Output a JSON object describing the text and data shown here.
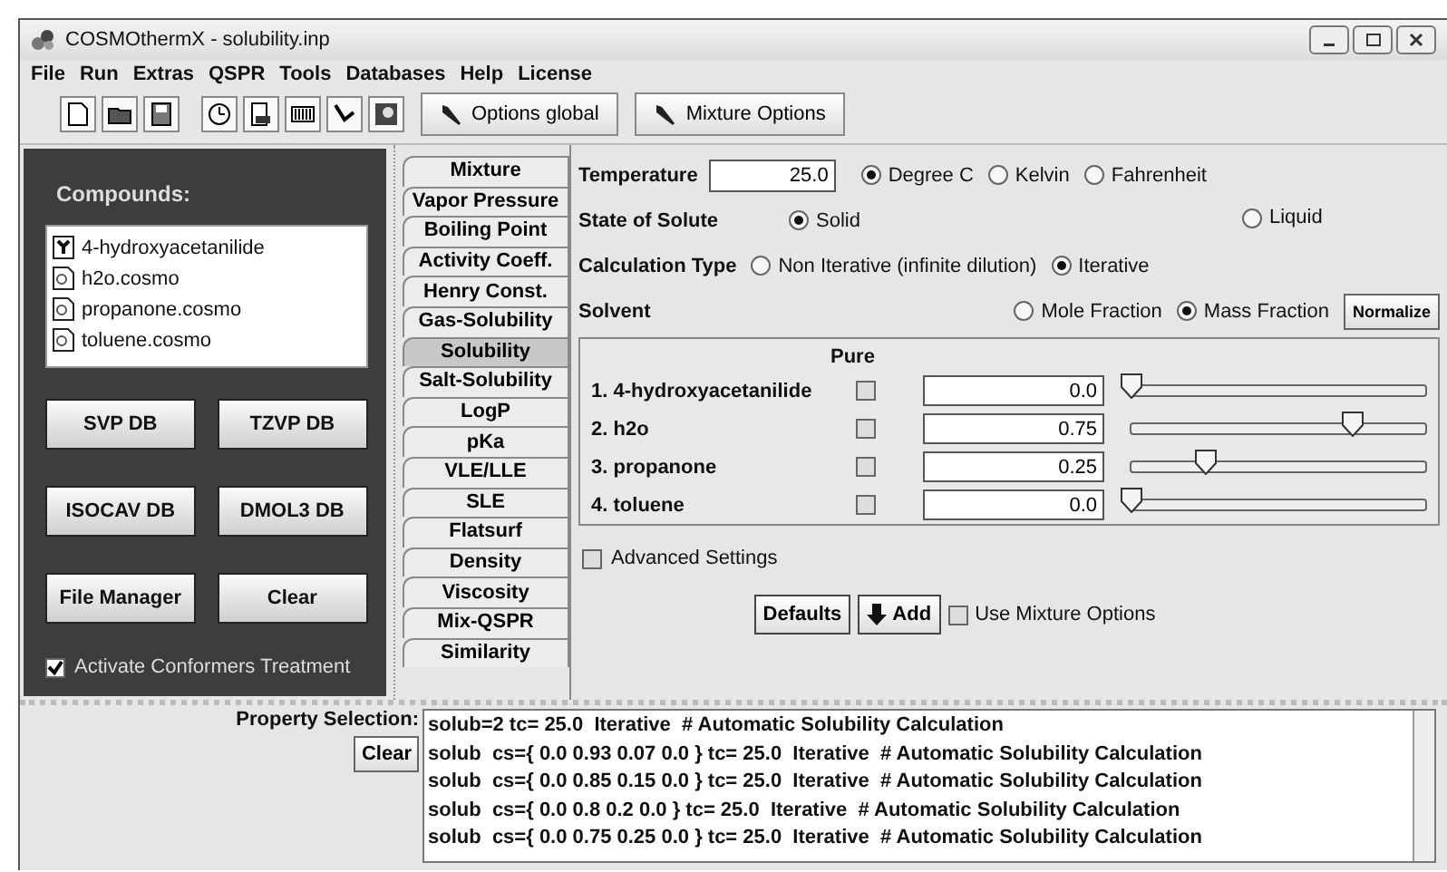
{
  "window": {
    "title": "COSMOthermX - solubility.inp"
  },
  "menu": [
    "File",
    "Run",
    "Extras",
    "QSPR",
    "Tools",
    "Databases",
    "Help",
    "License"
  ],
  "toolbar": {
    "buttons": [
      "Options global",
      "Mixture Options"
    ]
  },
  "compounds": {
    "title": "Compounds:",
    "items": [
      {
        "label": "4-hydroxyacetanilide",
        "kind": "solute"
      },
      {
        "label": "h2o.cosmo",
        "kind": "cosmo"
      },
      {
        "label": "propanone.cosmo",
        "kind": "cosmo"
      },
      {
        "label": "toluene.cosmo",
        "kind": "cosmo"
      }
    ]
  },
  "db_buttons": [
    "SVP DB",
    "TZVP DB",
    "ISOCAV DB",
    "DMOL3 DB",
    "File Manager",
    "Clear"
  ],
  "conformers": {
    "label": "Activate Conformers Treatment",
    "checked": true
  },
  "tabs": [
    {
      "label": "Mixture",
      "selected": false
    },
    {
      "label": "Vapor Pressure",
      "selected": false
    },
    {
      "label": "Boiling Point",
      "selected": false
    },
    {
      "label": "Activity Coeff.",
      "selected": false
    },
    {
      "label": "Henry Const.",
      "selected": false
    },
    {
      "label": "Gas-Solubility",
      "selected": false
    },
    {
      "label": "Solubility",
      "selected": true
    },
    {
      "label": "Salt-Solubility",
      "selected": false
    },
    {
      "label": "LogP",
      "selected": false
    },
    {
      "label": "pKa",
      "selected": false
    },
    {
      "label": "VLE/LLE",
      "selected": false
    },
    {
      "label": "SLE",
      "selected": false
    },
    {
      "label": "Flatsurf",
      "selected": false
    },
    {
      "label": "Density",
      "selected": false
    },
    {
      "label": "Viscosity",
      "selected": false
    },
    {
      "label": "Mix-QSPR",
      "selected": false
    },
    {
      "label": "Similarity",
      "selected": false
    }
  ],
  "temperature": {
    "label": "Temperature",
    "value": "25.0",
    "options": [
      {
        "label": "Degree C",
        "selected": true
      },
      {
        "label": "Kelvin",
        "selected": false
      },
      {
        "label": "Fahrenheit",
        "selected": false
      }
    ]
  },
  "state_of_solute": {
    "label": "State of Solute",
    "options": [
      {
        "label": "Solid",
        "selected": true
      },
      {
        "label": "Liquid",
        "selected": false
      }
    ]
  },
  "calculation_type": {
    "label": "Calculation Type",
    "options": [
      {
        "label": "Non Iterative (infinite dilution)",
        "selected": false
      },
      {
        "label": "Iterative",
        "selected": true
      }
    ]
  },
  "solvent": {
    "label": "Solvent",
    "options": [
      {
        "label": "Mole Fraction",
        "selected": false
      },
      {
        "label": "Mass Fraction",
        "selected": true
      }
    ],
    "button": "Normalize"
  },
  "components": {
    "header": "Pure",
    "rows": [
      {
        "index": "1.",
        "name": "4-hydroxyacetanilide",
        "pure": false,
        "value": "0.0",
        "level": 0
      },
      {
        "index": "2.",
        "name": "h2o",
        "pure": false,
        "value": "0.75",
        "level": 0.75
      },
      {
        "index": "3.",
        "name": "propanone",
        "pure": false,
        "value": "0.25",
        "level": 0.25
      },
      {
        "index": "4.",
        "name": "toluene",
        "pure": false,
        "value": "0.0",
        "level": 0
      }
    ]
  },
  "advanced": {
    "label": "Advanced Settings",
    "checked": false
  },
  "actions": {
    "defaults": "Defaults",
    "add": "Add",
    "use_mixture": {
      "label": "Use Mixture Options",
      "checked": false
    }
  },
  "property_selection": {
    "label": "Property Selection:",
    "clear": "Clear",
    "lines": [
      "solub=2 tc= 25.0  Iterative  # Automatic Solubility Calculation",
      "solub  cs={ 0.0 0.93 0.07 0.0 } tc= 25.0  Iterative  # Automatic Solubility Calculation",
      "solub  cs={ 0.0 0.85 0.15 0.0 } tc= 25.0  Iterative  # Automatic Solubility Calculation",
      "solub  cs={ 0.0 0.8 0.2 0.0 } tc= 25.0  Iterative  # Automatic Solubility Calculation",
      "solub  cs={ 0.0 0.75 0.25 0.0 } tc= 25.0  Iterative  # Automatic Solubility Calculation"
    ]
  }
}
